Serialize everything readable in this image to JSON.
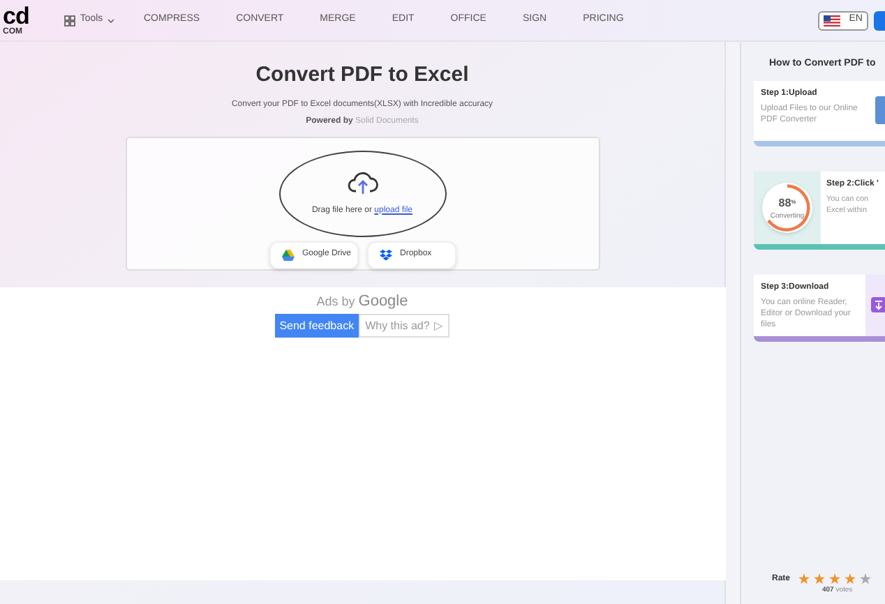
{
  "logo": {
    "mark": "cd",
    "suffix": "COM"
  },
  "nav": [
    {
      "label": "Tools",
      "kind": "menu"
    },
    {
      "label": "COMPRESS",
      "kind": "link"
    },
    {
      "label": "CONVERT",
      "kind": "link"
    },
    {
      "label": "MERGE",
      "kind": "link"
    },
    {
      "label": "EDIT",
      "kind": "link"
    },
    {
      "label": "OFFICE",
      "kind": "link"
    },
    {
      "label": "SIGN",
      "kind": "link"
    },
    {
      "label": "PRICING",
      "kind": "link"
    }
  ],
  "language": "EN",
  "hero": {
    "title": "Convert PDF to Excel",
    "subtitle": "Convert your PDF to Excel documents(XLSX) with Incredible accuracy",
    "powered_by": "Powered by",
    "powered_name": "Solid Documents"
  },
  "upload": {
    "text": "Drag file here or",
    "link": "upload file",
    "sources": [
      "Google Drive",
      "Dropbox"
    ]
  },
  "ad": {
    "label": "Ads by",
    "brand": "Google",
    "feedback": "Send feedback",
    "why": "Why this ad?",
    "why_icon": "▷"
  },
  "howto": {
    "title": "How to Convert PDF to",
    "steps": [
      {
        "kind": "upload",
        "title": "Step 1:Upload",
        "text": "Upload Files to our Online PDF Converter"
      },
      {
        "kind": "progress",
        "title": "Step 2:Click '",
        "lines": [
          "You can con",
          "Excel within"
        ],
        "percent": "88",
        "percent_sign": "%",
        "caption": "Converting"
      },
      {
        "kind": "download",
        "title": "Step 3:Download",
        "text": "You can online Reader, Editor or Download your files"
      }
    ]
  },
  "rating": {
    "label": "Rate",
    "stars": 4,
    "votes": "407",
    "votes_label": "votes"
  }
}
